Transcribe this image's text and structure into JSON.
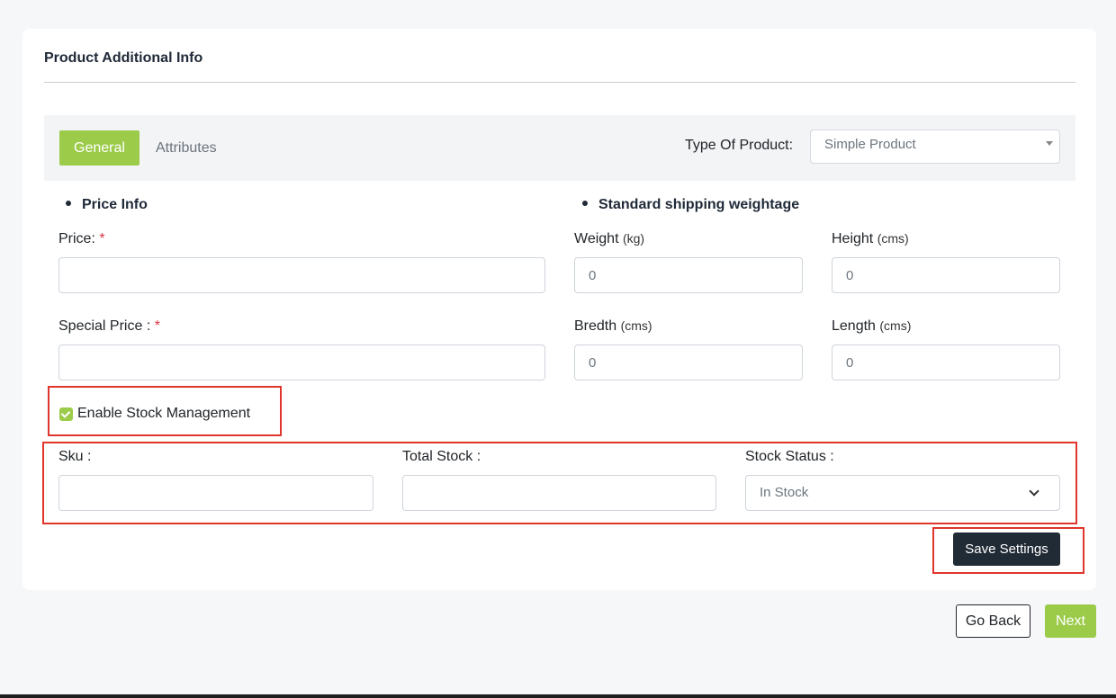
{
  "card": {
    "title": "Product Additional Info"
  },
  "tabs": {
    "general": "General",
    "attributes": "Attributes",
    "type_label": "Type Of Product:",
    "type_value": "Simple Product"
  },
  "price_info": {
    "heading": "Price Info",
    "price_label": "Price:",
    "special_price_label": "Special Price :",
    "required_mark": "*",
    "price_value": "",
    "special_price_value": ""
  },
  "shipping": {
    "heading": "Standard shipping weightage",
    "weight_label": "Weight",
    "weight_unit": "(kg)",
    "weight_value": "0",
    "height_label": "Height",
    "height_unit": "(cms)",
    "height_value": "0",
    "bredth_label": "Bredth",
    "bredth_unit": "(cms)",
    "bredth_value": "0",
    "length_label": "Length",
    "length_unit": "(cms)",
    "length_value": "0"
  },
  "stock": {
    "enable_label": "Enable Stock Management",
    "enabled": true,
    "sku_label": "Sku :",
    "sku_value": "",
    "total_label": "Total Stock :",
    "total_value": "",
    "status_label": "Stock Status :",
    "status_value": "In Stock"
  },
  "actions": {
    "save": "Save Settings",
    "go_back": "Go Back",
    "next": "Next"
  },
  "colors": {
    "accent_green": "#9ccb4a",
    "dark_button": "#212b36",
    "required_red": "#dc3545",
    "highlight_red": "#e0352b"
  }
}
